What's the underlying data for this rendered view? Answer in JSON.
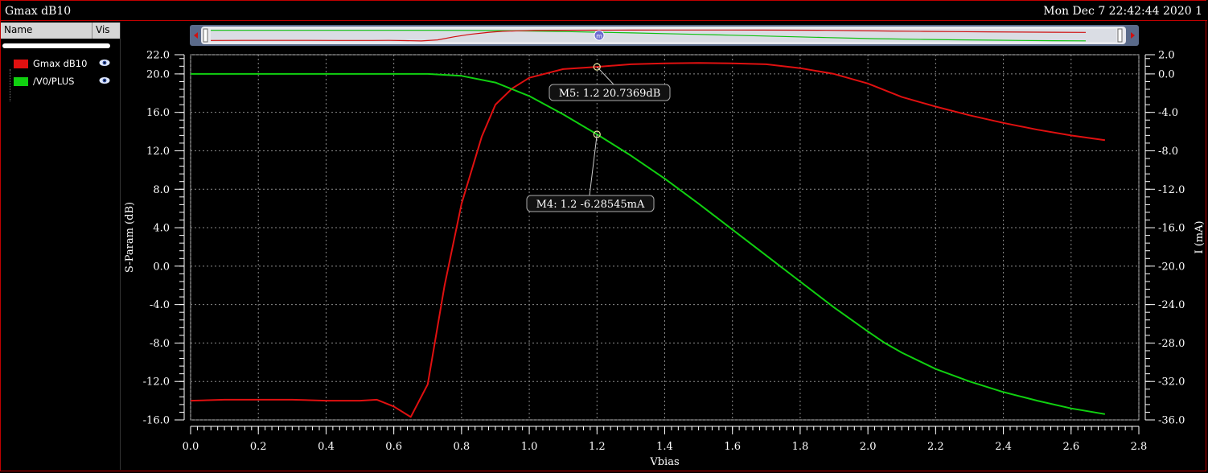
{
  "window": {
    "title": "Gmax dB10",
    "timestamp": "Mon Dec 7 22:42:44 2020  1"
  },
  "sidebar": {
    "headers": {
      "name": "Name",
      "vis": "Vis"
    },
    "items": [
      {
        "label": "Gmax dB10",
        "color": "#e01010",
        "icon": "eye-icon"
      },
      {
        "label": "/V0/PLUS",
        "color": "#10d010",
        "icon": "eye-icon"
      }
    ]
  },
  "chart_data": {
    "type": "line",
    "xlabel": "Vbias",
    "ylabel": "S-Param (dB)",
    "y2label": "I (mA)",
    "xlim": [
      0.0,
      2.8
    ],
    "ylim": [
      -16.0,
      22.0
    ],
    "y2lim": [
      -36.0,
      2.0
    ],
    "xticks": [
      "0.0",
      "0.2",
      "0.4",
      "0.6",
      "0.8",
      "1.0",
      "1.2",
      "1.4",
      "1.6",
      "1.8",
      "2.0",
      "2.2",
      "2.4",
      "2.6",
      "2.8"
    ],
    "yticks": [
      "22.0",
      "20.0",
      "16.0",
      "12.0",
      "8.0",
      "4.0",
      "0.0",
      "-4.0",
      "-8.0",
      "-12.0",
      "-16.0"
    ],
    "y2ticks": [
      "2.0",
      "0.0",
      "-4.0",
      "-8.0",
      "-12.0",
      "-16.0",
      "-20.0",
      "-24.0",
      "-28.0",
      "-32.0",
      "-36.0"
    ],
    "grid": true,
    "series": [
      {
        "name": "Gmax dB10",
        "axis": "left",
        "color": "#e01010",
        "points": [
          [
            0.0,
            -14.0
          ],
          [
            0.1,
            -13.9
          ],
          [
            0.2,
            -13.9
          ],
          [
            0.3,
            -13.9
          ],
          [
            0.4,
            -14.0
          ],
          [
            0.5,
            -14.0
          ],
          [
            0.55,
            -13.9
          ],
          [
            0.6,
            -14.6
          ],
          [
            0.65,
            -15.7
          ],
          [
            0.7,
            -12.3
          ],
          [
            0.75,
            -2.0
          ],
          [
            0.8,
            6.5
          ],
          [
            0.86,
            13.5
          ],
          [
            0.9,
            16.8
          ],
          [
            0.95,
            18.5
          ],
          [
            1.0,
            19.6
          ],
          [
            1.1,
            20.5
          ],
          [
            1.2,
            20.74
          ],
          [
            1.3,
            21.0
          ],
          [
            1.4,
            21.1
          ],
          [
            1.5,
            21.15
          ],
          [
            1.6,
            21.1
          ],
          [
            1.7,
            21.0
          ],
          [
            1.8,
            20.6
          ],
          [
            1.9,
            20.0
          ],
          [
            2.0,
            19.0
          ],
          [
            2.1,
            17.6
          ],
          [
            2.2,
            16.6
          ],
          [
            2.3,
            15.7
          ],
          [
            2.4,
            14.9
          ],
          [
            2.5,
            14.2
          ],
          [
            2.6,
            13.6
          ],
          [
            2.7,
            13.1
          ]
        ]
      },
      {
        "name": "/V0/PLUS",
        "axis": "right",
        "color": "#10d010",
        "points": [
          [
            0.0,
            0.0
          ],
          [
            0.2,
            0.0
          ],
          [
            0.4,
            0.0
          ],
          [
            0.6,
            0.0
          ],
          [
            0.7,
            0.0
          ],
          [
            0.8,
            -0.2
          ],
          [
            0.9,
            -0.9
          ],
          [
            1.0,
            -2.3
          ],
          [
            1.1,
            -4.2
          ],
          [
            1.2,
            -6.29
          ],
          [
            1.3,
            -8.5
          ],
          [
            1.4,
            -10.9
          ],
          [
            1.5,
            -13.5
          ],
          [
            1.6,
            -16.2
          ],
          [
            1.7,
            -18.9
          ],
          [
            1.8,
            -21.6
          ],
          [
            1.9,
            -24.3
          ],
          [
            2.0,
            -26.8
          ],
          [
            2.05,
            -28.0
          ],
          [
            2.1,
            -29.0
          ],
          [
            2.2,
            -30.7
          ],
          [
            2.3,
            -32.0
          ],
          [
            2.4,
            -33.1
          ],
          [
            2.5,
            -34.0
          ],
          [
            2.6,
            -34.8
          ],
          [
            2.7,
            -35.4
          ]
        ]
      }
    ],
    "markers": [
      {
        "name": "M5",
        "label": "M5: 1.2 20.7369dB",
        "x": 1.2,
        "y": 20.7369,
        "axis": "left"
      },
      {
        "name": "M4",
        "label": "M4: 1.2 -6.28545mA",
        "x": 1.2,
        "y": -6.28545,
        "axis": "right"
      }
    ]
  }
}
